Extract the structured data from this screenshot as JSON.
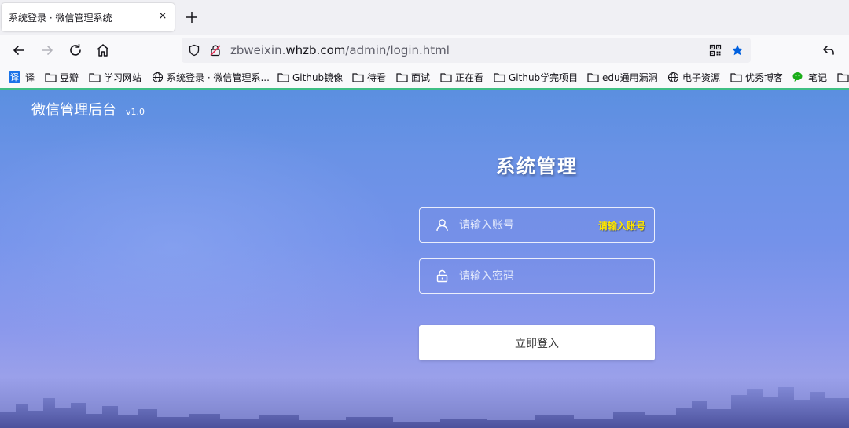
{
  "browser": {
    "tab_title": "系统登录 · 微信管理系统",
    "tab_close": "×",
    "url_prefix": "zbweixin.",
    "url_domain": "whzb.com",
    "url_path": "/admin/login.html",
    "bookmarks": [
      {
        "label": "译",
        "icon": "translate-icon"
      },
      {
        "label": "豆瓣",
        "icon": "folder-icon"
      },
      {
        "label": "学习网站",
        "icon": "folder-icon"
      },
      {
        "label": "系统登录 · 微信管理系...",
        "icon": "globe-icon"
      },
      {
        "label": "Github镜像",
        "icon": "folder-icon"
      },
      {
        "label": "待看",
        "icon": "folder-icon"
      },
      {
        "label": "面试",
        "icon": "folder-icon"
      },
      {
        "label": "正在看",
        "icon": "folder-icon"
      },
      {
        "label": "Github学完项目",
        "icon": "folder-icon"
      },
      {
        "label": "edu通用漏洞",
        "icon": "folder-icon"
      },
      {
        "label": "电子资源",
        "icon": "globe-icon"
      },
      {
        "label": "优秀博客",
        "icon": "folder-icon"
      },
      {
        "label": "笔记",
        "icon": "wechat-icon"
      }
    ],
    "bookmark_star_color": "#0060df",
    "toolbar_line_color": "#3fbf84"
  },
  "page": {
    "brand_title": "微信管理后台",
    "brand_version": "v1.0",
    "login_title": "系统管理",
    "username": {
      "placeholder": "请输入账号",
      "value": "",
      "error": "请输入账号"
    },
    "password": {
      "placeholder": "请输入密码",
      "value": ""
    },
    "login_button": "立即登入",
    "error_color": "#ffe600"
  }
}
